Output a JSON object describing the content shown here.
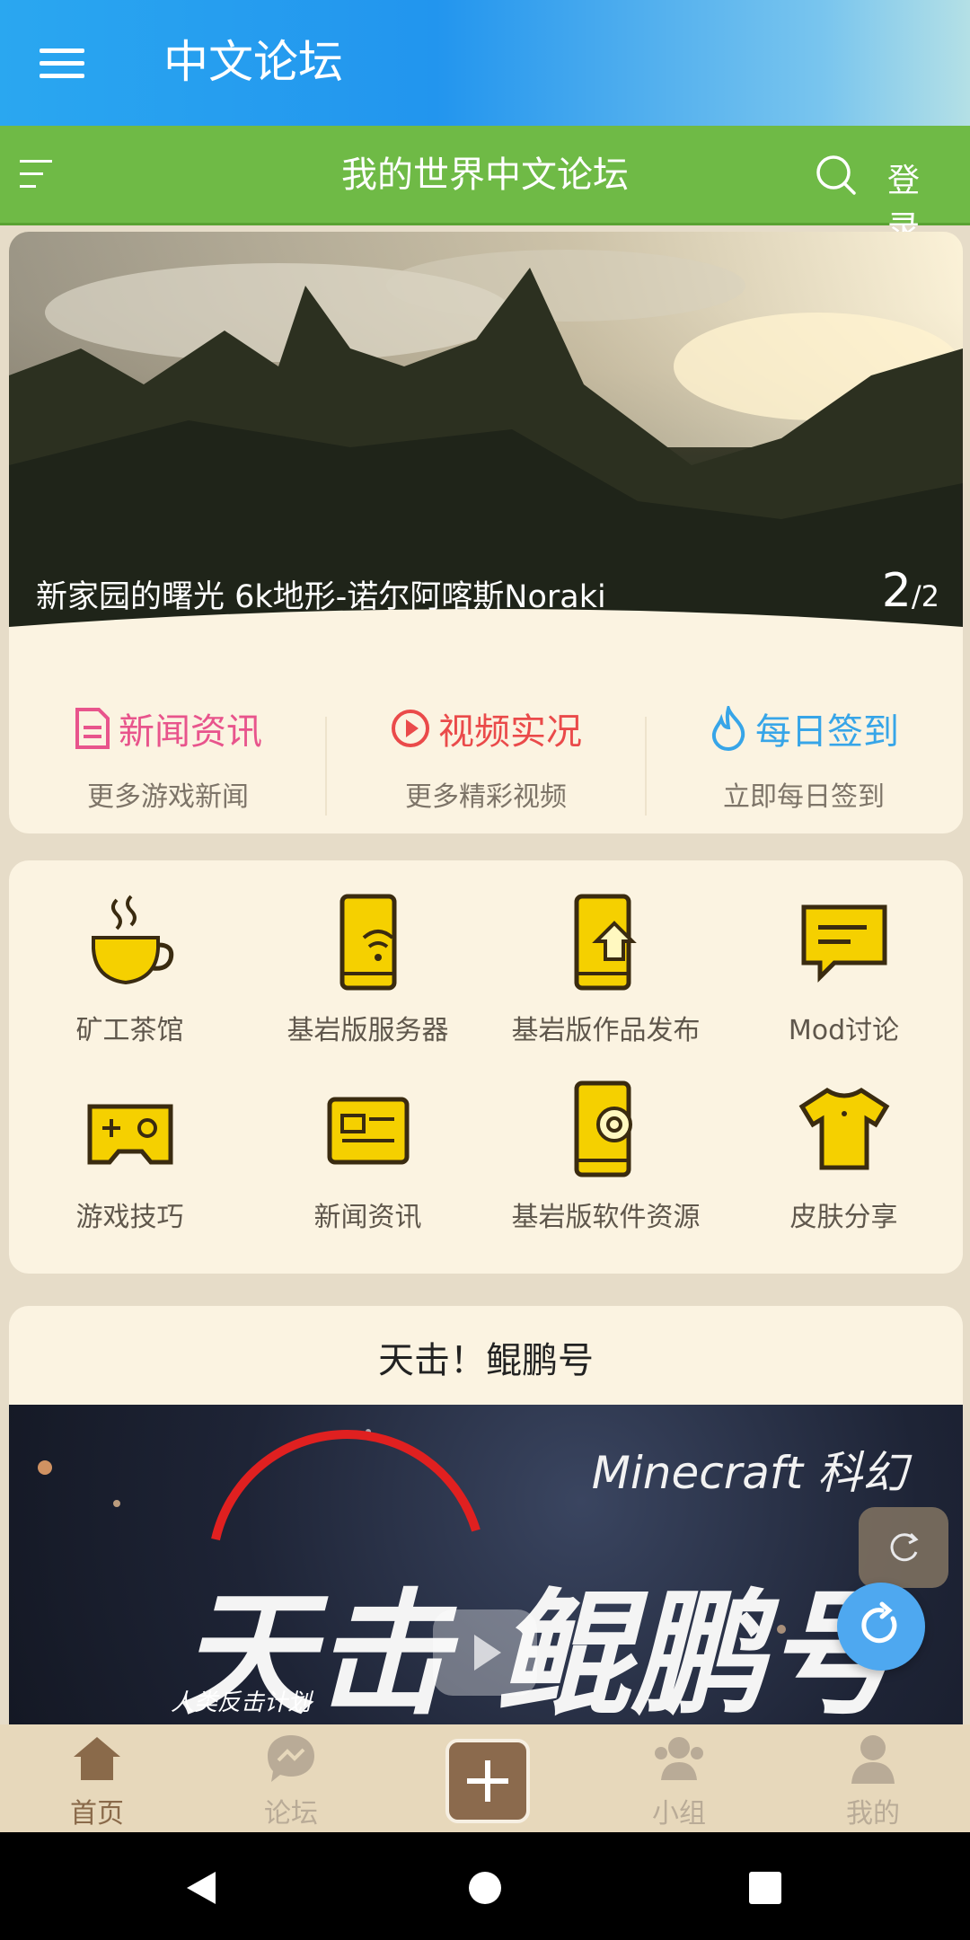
{
  "app_bar": {
    "title": "中文论坛"
  },
  "sub_bar": {
    "title": "我的世界中文论坛",
    "login": "登 录"
  },
  "banner": {
    "caption": "新家园的曙光 6k地形-诺尔阿喀斯Noraki",
    "current": "2",
    "total": "/2"
  },
  "quick_links": [
    {
      "title": "新闻资讯",
      "subtitle": "更多游戏新闻",
      "icon": "document-icon",
      "color": "#e8548c"
    },
    {
      "title": "视频实况",
      "subtitle": "更多精彩视频",
      "icon": "play-circle-icon",
      "color": "#ea4a4a"
    },
    {
      "title": "每日签到",
      "subtitle": "立即每日签到",
      "icon": "flame-icon",
      "color": "#37a5e8"
    }
  ],
  "categories": [
    {
      "label": "矿工茶馆",
      "icon": "teacup-icon"
    },
    {
      "label": "基岩版服务器",
      "icon": "phone-wifi-icon"
    },
    {
      "label": "基岩版作品发布",
      "icon": "phone-upload-icon"
    },
    {
      "label": "Mod讨论",
      "icon": "chat-bubble-icon"
    },
    {
      "label": "游戏技巧",
      "icon": "gamepad-icon"
    },
    {
      "label": "新闻资讯",
      "icon": "newspaper-icon"
    },
    {
      "label": "基岩版软件资源",
      "icon": "phone-gear-icon"
    },
    {
      "label": "皮肤分享",
      "icon": "tshirt-icon"
    }
  ],
  "post": {
    "title": "天击！鲲鹏号",
    "image_text": "Minecraft 科幻"
  },
  "tabs": [
    {
      "label": "首页",
      "icon": "home-icon",
      "active": true
    },
    {
      "label": "论坛",
      "icon": "forum-icon",
      "active": false
    },
    {
      "label": "小组",
      "icon": "group-icon",
      "active": false
    },
    {
      "label": "我的",
      "icon": "person-icon",
      "active": false
    }
  ],
  "colors": {
    "app_bar": "#2295ee",
    "sub_bar": "#6fba46",
    "category_icon": "#f5d000",
    "tab_active": "#8a6a4a"
  }
}
